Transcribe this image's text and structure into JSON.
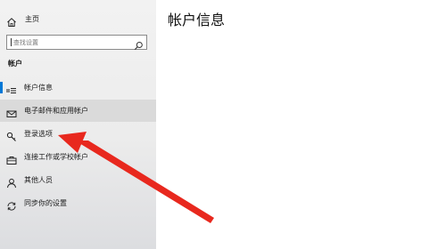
{
  "main": {
    "title": "帐户信息"
  },
  "sidebar": {
    "home": {
      "label": "主页",
      "icon": "home-icon"
    },
    "search": {
      "placeholder": "查找设置",
      "icon": "search-icon"
    },
    "section_header": "帐户",
    "items": [
      {
        "label": "帐户信息",
        "icon": "account-info-icon",
        "selected": true
      },
      {
        "label": "电子邮件和应用帐户",
        "icon": "mail-icon"
      },
      {
        "label": "登录选项",
        "icon": "key-icon"
      },
      {
        "label": "连接工作或学校帐户",
        "icon": "briefcase-icon"
      },
      {
        "label": "其他人员",
        "icon": "person-icon"
      },
      {
        "label": "同步你的设置",
        "icon": "sync-icon"
      }
    ]
  },
  "colors": {
    "accent": "#0078d7",
    "annotation_arrow": "#e8281e"
  }
}
